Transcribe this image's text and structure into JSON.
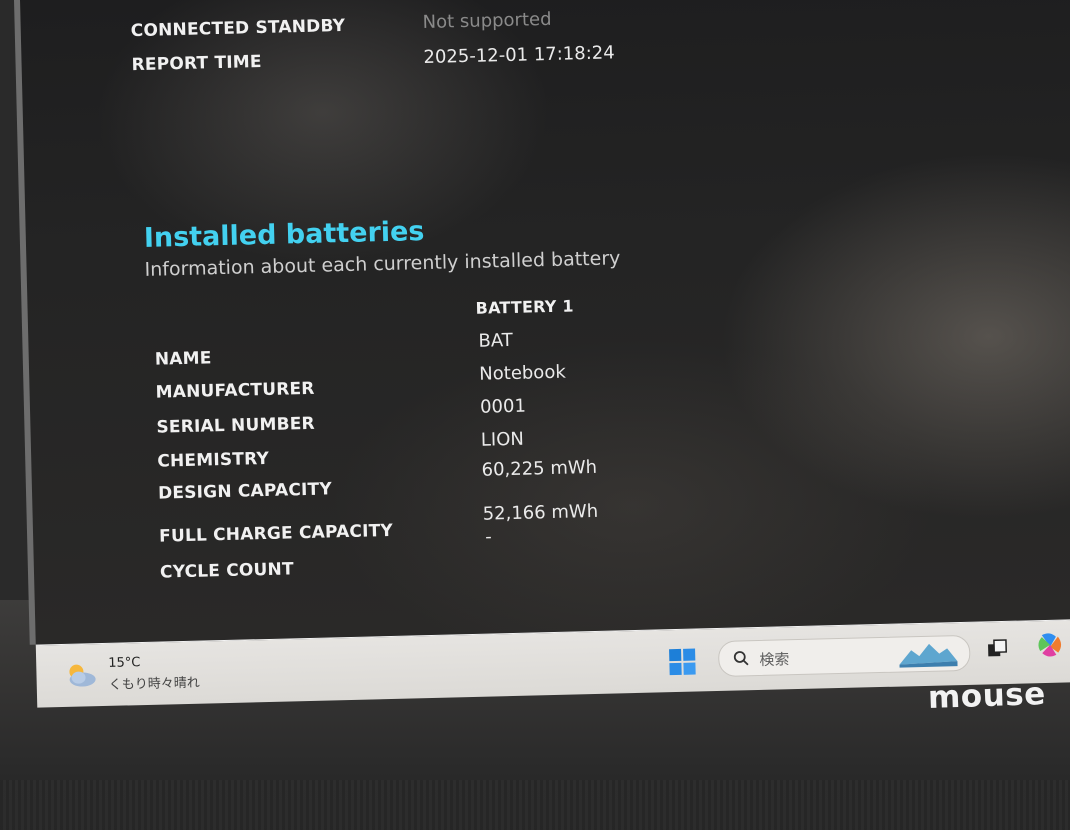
{
  "header_rows": [
    {
      "label": "CONNECTED STANDBY",
      "value": "Not supported"
    },
    {
      "label": "REPORT TIME",
      "value": "2025-12-01  17:18:24"
    }
  ],
  "section": {
    "title": "Installed batteries",
    "subtitle": "Information about each currently installed battery"
  },
  "battery_table": {
    "column_header": "BATTERY 1",
    "rows": [
      {
        "label": "NAME",
        "value": "BAT"
      },
      {
        "label": "MANUFACTURER",
        "value": "Notebook"
      },
      {
        "label": "SERIAL NUMBER",
        "value": "0001"
      },
      {
        "label": "CHEMISTRY",
        "value": "LION"
      },
      {
        "label": "DESIGN CAPACITY",
        "value": "60,225 mWh"
      },
      {
        "label": "FULL CHARGE CAPACITY",
        "value": "52,166 mWh"
      },
      {
        "label": "CYCLE COUNT",
        "value": "-"
      }
    ]
  },
  "taskbar": {
    "weather": {
      "temp": "15°C",
      "desc": "くもり時々晴れ",
      "icon": "partly-cloudy-icon"
    },
    "start_icon": "windows-logo-icon",
    "search": {
      "placeholder": "検索",
      "icon": "search-icon"
    },
    "taskview_icon": "task-view-icon",
    "copilot_icon": "copilot-icon",
    "colors": {
      "accent": "#0078d4",
      "title": "#43d1f0"
    }
  },
  "bezel": {
    "brand": "mouse"
  }
}
